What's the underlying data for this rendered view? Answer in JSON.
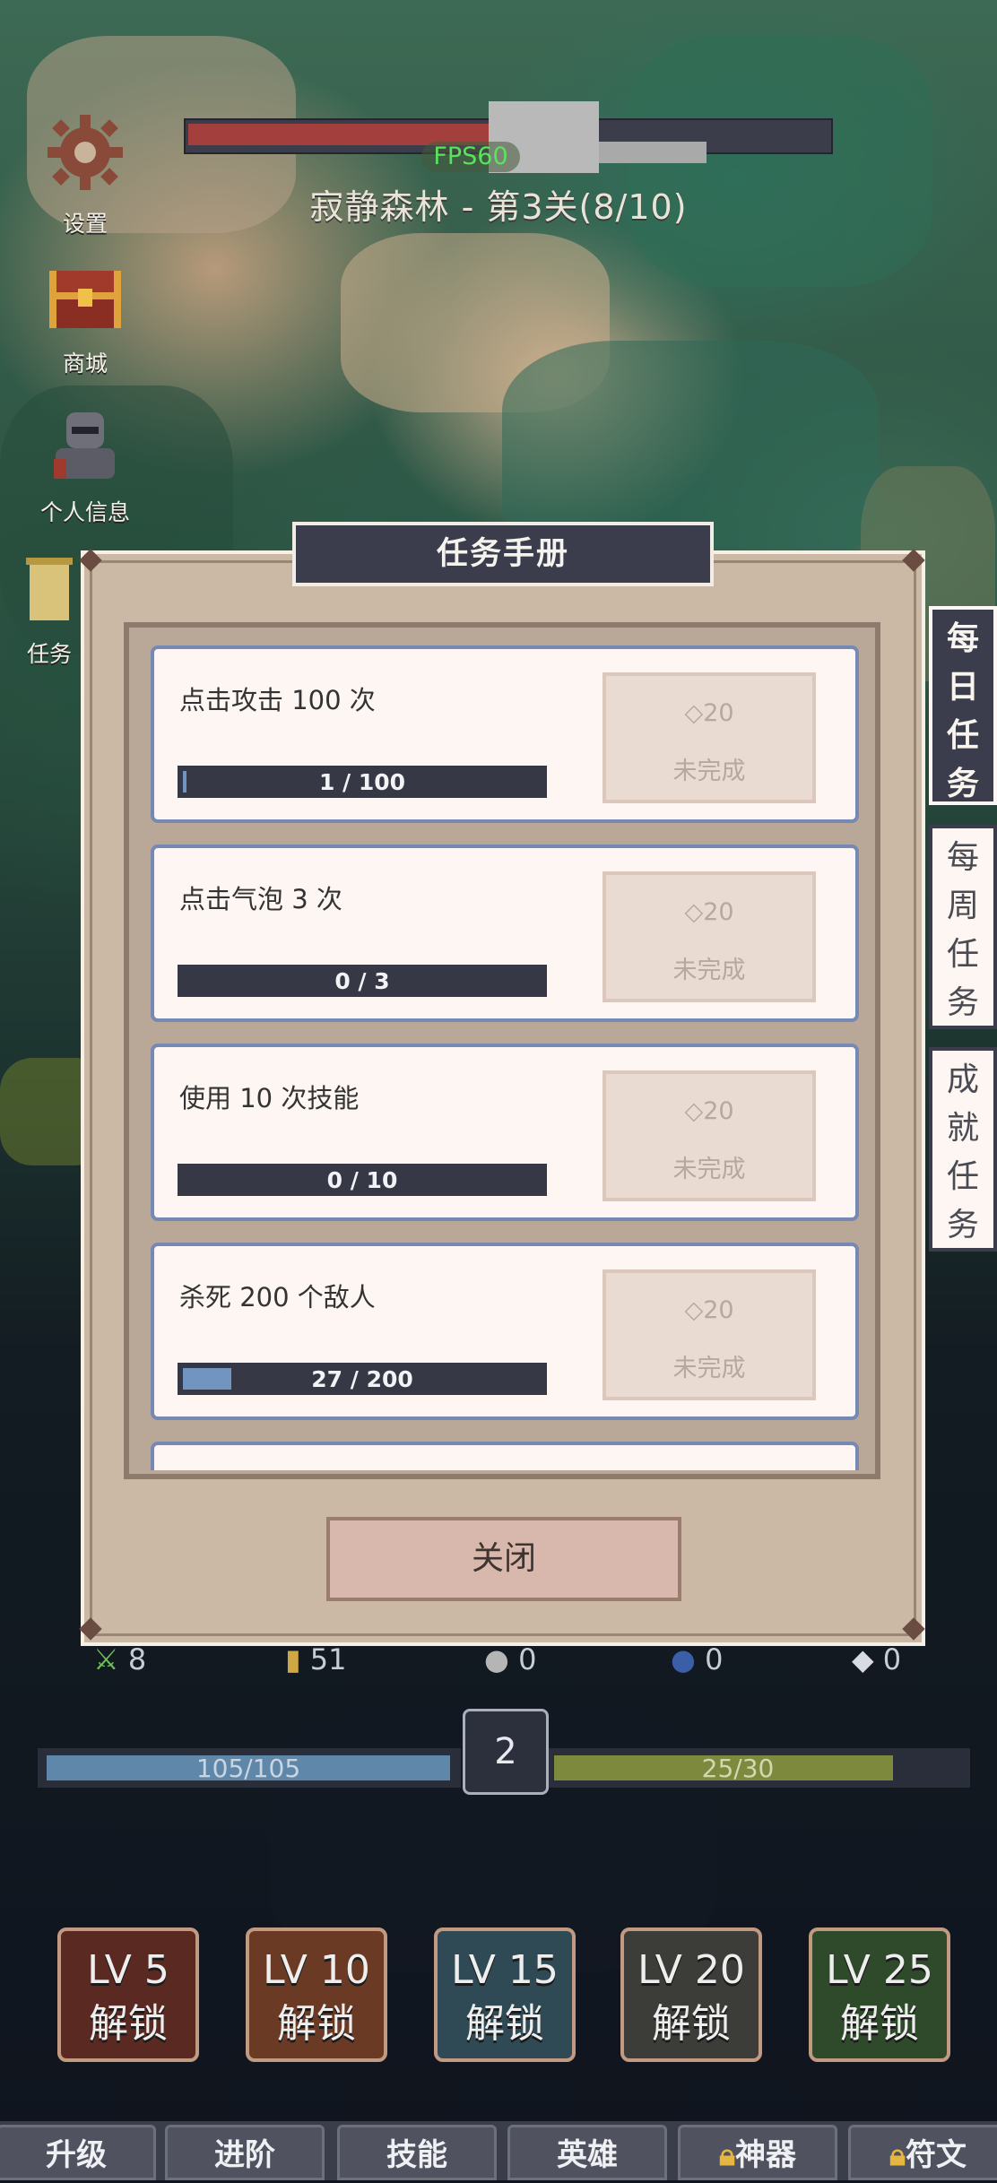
{
  "hud": {
    "fps": "FPS60",
    "stage": "寂静森林 - 第3关(8/10)",
    "hp_fraction": 0.47
  },
  "side_menu": [
    {
      "label": "设置",
      "icon": "gear-icon"
    },
    {
      "label": "商城",
      "icon": "treasure-chest-icon"
    },
    {
      "label": "个人信息",
      "icon": "knight-avatar-icon"
    },
    {
      "label": "任务",
      "icon": "scroll-icon"
    }
  ],
  "resources": [
    {
      "icon": "sword-icon",
      "value": "8"
    },
    {
      "icon": "scroll-icon",
      "value": "51"
    },
    {
      "icon": "silver-coin-icon",
      "value": "0"
    },
    {
      "icon": "blue-orb-icon",
      "value": "0"
    },
    {
      "icon": "diamond-icon",
      "value": "0"
    }
  ],
  "bars": {
    "hp_text": "105/105",
    "level": "2",
    "exp_text": "25/30",
    "exp_fraction": 0.833
  },
  "skills": [
    {
      "lv": "LV 5",
      "status": "解锁"
    },
    {
      "lv": "LV 10",
      "status": "解锁"
    },
    {
      "lv": "LV 15",
      "status": "解锁"
    },
    {
      "lv": "LV 20",
      "status": "解锁"
    },
    {
      "lv": "LV 25",
      "status": "解锁"
    }
  ],
  "bottom_tabs": [
    {
      "label": "升级",
      "locked": false
    },
    {
      "label": "进阶",
      "locked": false
    },
    {
      "label": "技能",
      "locked": false
    },
    {
      "label": "英雄",
      "locked": false
    },
    {
      "label": "神器",
      "locked": true
    },
    {
      "label": "符文",
      "locked": true
    }
  ],
  "modal": {
    "title": "任务手册",
    "close_label": "关闭",
    "side_tabs": [
      {
        "label": "每日任务",
        "active": true
      },
      {
        "label": "每周任务",
        "active": false
      },
      {
        "label": "成就任务",
        "active": false
      }
    ],
    "tasks": [
      {
        "title": "点击攻击 100 次",
        "progress": "1 / 100",
        "fraction": 0.01,
        "reward": "20",
        "status": "未完成"
      },
      {
        "title": "点击气泡 3 次",
        "progress": "0 / 3",
        "fraction": 0,
        "reward": "20",
        "status": "未完成"
      },
      {
        "title": "使用 10 次技能",
        "progress": "0 / 10",
        "fraction": 0,
        "reward": "20",
        "status": "未完成"
      },
      {
        "title": "杀死 200 个敌人",
        "progress": "27 / 200",
        "fraction": 0.135,
        "reward": "20",
        "status": "未完成"
      }
    ]
  },
  "colors": {
    "panel": "#ccb9a5",
    "card_border": "#7688b4",
    "dark": "#3b3d4c"
  }
}
